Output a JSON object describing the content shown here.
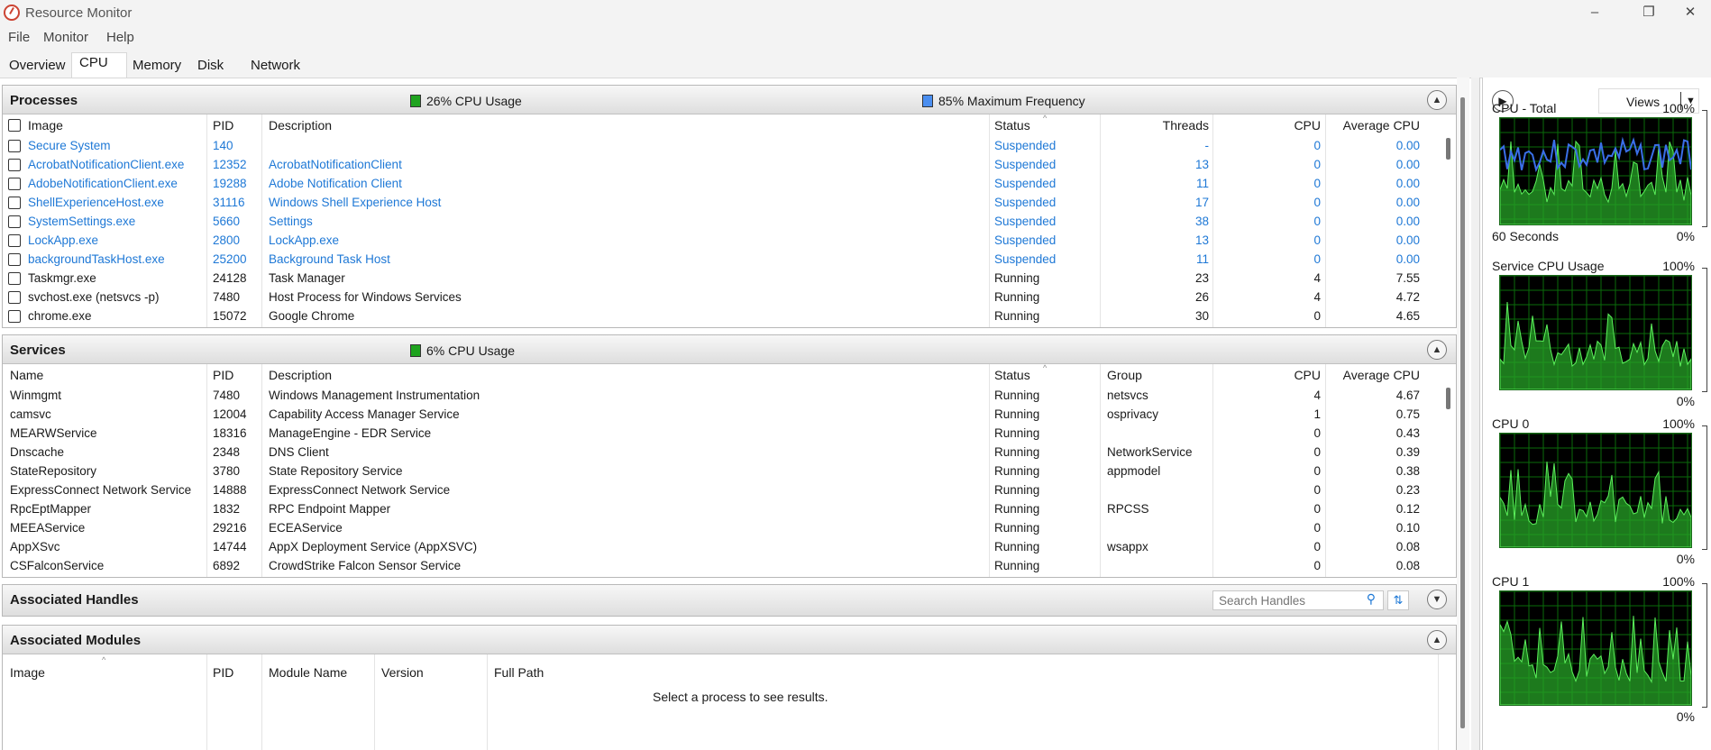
{
  "window": {
    "title": "Resource Monitor"
  },
  "menu": [
    "File",
    "Monitor",
    "Help"
  ],
  "tabs": [
    "Overview",
    "CPU",
    "Memory",
    "Disk",
    "Network"
  ],
  "processes": {
    "title": "Processes",
    "cpu_usage": "26% CPU Usage",
    "max_freq": "85% Maximum Frequency",
    "columns": [
      "Image",
      "PID",
      "Description",
      "Status",
      "Threads",
      "CPU",
      "Average CPU"
    ],
    "rows": [
      [
        "Secure System",
        "140",
        "",
        "Suspended",
        "-",
        "0",
        "0.00"
      ],
      [
        "AcrobatNotificationClient.exe",
        "12352",
        "AcrobatNotificationClient",
        "Suspended",
        "13",
        "0",
        "0.00"
      ],
      [
        "AdobeNotificationClient.exe",
        "19288",
        "Adobe Notification Client",
        "Suspended",
        "11",
        "0",
        "0.00"
      ],
      [
        "ShellExperienceHost.exe",
        "31116",
        "Windows Shell Experience Host",
        "Suspended",
        "17",
        "0",
        "0.00"
      ],
      [
        "SystemSettings.exe",
        "5660",
        "Settings",
        "Suspended",
        "38",
        "0",
        "0.00"
      ],
      [
        "LockApp.exe",
        "2800",
        "LockApp.exe",
        "Suspended",
        "13",
        "0",
        "0.00"
      ],
      [
        "backgroundTaskHost.exe",
        "25200",
        "Background Task Host",
        "Suspended",
        "11",
        "0",
        "0.00"
      ],
      [
        "Taskmgr.exe",
        "24128",
        "Task Manager",
        "Running",
        "23",
        "4",
        "7.55"
      ],
      [
        "svchost.exe (netsvcs -p)",
        "7480",
        "Host Process for Windows Services",
        "Running",
        "26",
        "4",
        "4.72"
      ],
      [
        "chrome.exe",
        "15072",
        "Google Chrome",
        "Running",
        "30",
        "0",
        "4.65"
      ]
    ]
  },
  "services": {
    "title": "Services",
    "cpu_usage": "6% CPU Usage",
    "columns": [
      "Name",
      "PID",
      "Description",
      "Status",
      "Group",
      "CPU",
      "Average CPU"
    ],
    "rows": [
      [
        "Winmgmt",
        "7480",
        "Windows Management Instrumentation",
        "Running",
        "netsvcs",
        "4",
        "4.67"
      ],
      [
        "camsvc",
        "12004",
        "Capability Access Manager Service",
        "Running",
        "osprivacy",
        "1",
        "0.75"
      ],
      [
        "MEARWService",
        "18316",
        "ManageEngine - EDR Service",
        "Running",
        "",
        "0",
        "0.43"
      ],
      [
        "Dnscache",
        "2348",
        "DNS Client",
        "Running",
        "NetworkService",
        "0",
        "0.39"
      ],
      [
        "StateRepository",
        "3780",
        "State Repository Service",
        "Running",
        "appmodel",
        "0",
        "0.38"
      ],
      [
        "ExpressConnect Network Service",
        "14888",
        "ExpressConnect Network Service",
        "Running",
        "",
        "0",
        "0.23"
      ],
      [
        "RpcEptMapper",
        "1832",
        "RPC Endpoint Mapper",
        "Running",
        "RPCSS",
        "0",
        "0.12"
      ],
      [
        "MEEAService",
        "29216",
        "ECEAService",
        "Running",
        "",
        "0",
        "0.10"
      ],
      [
        "AppXSvc",
        "14744",
        "AppX Deployment Service (AppXSVC)",
        "Running",
        "wsappx",
        "0",
        "0.08"
      ],
      [
        "CSFalconService",
        "6892",
        "CrowdStrike Falcon Sensor Service",
        "Running",
        "",
        "0",
        "0.08"
      ]
    ]
  },
  "handles": {
    "title": "Associated Handles",
    "search_placeholder": "Search Handles"
  },
  "modules": {
    "title": "Associated Modules",
    "columns": [
      "Image",
      "PID",
      "Module Name",
      "Version",
      "Full Path"
    ],
    "empty_message": "Select a process to see results."
  },
  "right_panel": {
    "views_label": "Views",
    "graphs": [
      {
        "title": "CPU - Total",
        "top": "100%",
        "bottom_left": "60 Seconds",
        "bottom_right": "0%"
      },
      {
        "title": "Service CPU Usage",
        "top": "100%",
        "bottom_left": "",
        "bottom_right": "0%"
      },
      {
        "title": "CPU 0",
        "top": "100%",
        "bottom_left": "",
        "bottom_right": "0%"
      },
      {
        "title": "CPU 1",
        "top": "100%",
        "bottom_left": "",
        "bottom_right": "0%"
      }
    ]
  },
  "colors": {
    "link_blue": "#1e78d6",
    "graph_green": "#2ecc2e",
    "graph_blue": "#3a6fe8"
  }
}
